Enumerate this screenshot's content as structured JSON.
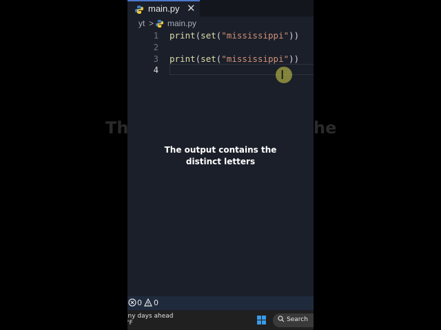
{
  "overlay": {
    "ghost_left": "Th",
    "ghost_right": "he",
    "caption_line1": "The output contains the",
    "caption_line2": "distinct letters"
  },
  "editor": {
    "tab": {
      "filename": "main.py",
      "close_glyph": "✕"
    },
    "breadcrumb": {
      "folder": "yt",
      "separator": ">",
      "file": "main.py"
    },
    "line_numbers": [
      "1",
      "2",
      "3",
      "4"
    ],
    "active_line": 4,
    "code_lines": [
      {
        "fn1": "print",
        "p1": "(",
        "fn2": "set",
        "p2": "(",
        "str": "\"mississippi\"",
        "p3": "))"
      },
      null,
      {
        "fn1": "print",
        "p1": "(",
        "fn2": "set",
        "p2": "(",
        "str": "\"mississippi\"",
        "p3": "))"
      },
      null
    ]
  },
  "status_bar": {
    "errors": "0",
    "warnings": "0"
  },
  "taskbar": {
    "weather_line1": "iny days ahead",
    "weather_line2": "°F",
    "search_label": "Search"
  },
  "colors": {
    "editor_bg": "#1b1f29",
    "accent_tab": "#4d78cc",
    "string": "#ce9178",
    "function": "#dcdcaa",
    "status_bar": "#1f2b3d",
    "cursor_highlight": "#c8c64a"
  },
  "icons": {
    "tab_icon": "python-icon",
    "breadcrumb_icon": "python-icon",
    "errors_icon": "error-circle-icon",
    "warnings_icon": "warning-triangle-icon",
    "start_icon": "windows-logo-icon",
    "search_icon": "search-icon",
    "cursor_icon": "ibeam-cursor-icon"
  }
}
